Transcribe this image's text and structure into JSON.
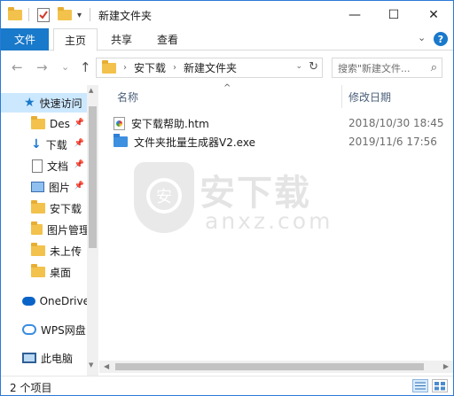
{
  "window": {
    "title": "新建文件夹",
    "controls": {
      "minimize": "—",
      "maximize": "☐",
      "close": "✕"
    }
  },
  "quick_access_toolbar": {
    "dropdown": "▾"
  },
  "ribbon": {
    "tabs": [
      {
        "label": "文件"
      },
      {
        "label": "主页"
      },
      {
        "label": "共享"
      },
      {
        "label": "查看"
      }
    ],
    "expand_glyph": "⌄",
    "help_glyph": "?"
  },
  "navigation": {
    "back": "←",
    "forward": "→",
    "history": "⌄",
    "up": "↑",
    "breadcrumb": [
      "安下载",
      "新建文件夹"
    ],
    "breadcrumb_sep": "›",
    "address_dropdown": "⌄",
    "refresh": "↻",
    "search_placeholder": "搜索\"新建文件...",
    "search_glyph": "⌕"
  },
  "sidebar": {
    "items": [
      {
        "label": "快速访问",
        "icon": "star-icon"
      },
      {
        "label": "Des",
        "icon": "folder-icon",
        "pinned": true
      },
      {
        "label": "下载",
        "icon": "download-icon",
        "pinned": true
      },
      {
        "label": "文档",
        "icon": "document-icon",
        "pinned": true
      },
      {
        "label": "图片",
        "icon": "picture-icon",
        "pinned": true
      },
      {
        "label": "安下载",
        "icon": "folder-icon"
      },
      {
        "label": "图片管理",
        "icon": "folder-icon"
      },
      {
        "label": "未上传",
        "icon": "folder-icon"
      },
      {
        "label": "桌面",
        "icon": "folder-icon"
      },
      {
        "label": "OneDrive",
        "icon": "onedrive-icon"
      },
      {
        "label": "WPS网盘",
        "icon": "wps-cloud-icon"
      },
      {
        "label": "此电脑",
        "icon": "computer-icon"
      }
    ],
    "pin_glyph": "📌",
    "scroll_up": "▲",
    "scroll_down": "▼"
  },
  "content": {
    "columns": {
      "name": "名称",
      "modified": "修改日期"
    },
    "sort_glyph": "^",
    "files": [
      {
        "name": "安下载帮助.htm",
        "modified": "2018/10/30 18:45",
        "icon": "htm-file-icon"
      },
      {
        "name": "文件夹批量生成器V2.exe",
        "modified": "2019/11/6 17:56",
        "icon": "exe-file-icon"
      }
    ]
  },
  "watermark": {
    "cn": "安下载",
    "en": "anxz.com",
    "badge": "安"
  },
  "hscroll": {
    "left": "◀",
    "right": "▶"
  },
  "status_bar": {
    "count": "2 个项目"
  },
  "colors": {
    "accent": "#1979ca",
    "selected_bg": "#cce8ff",
    "folder": "#f3c24c",
    "column_header": "#4c607a"
  }
}
